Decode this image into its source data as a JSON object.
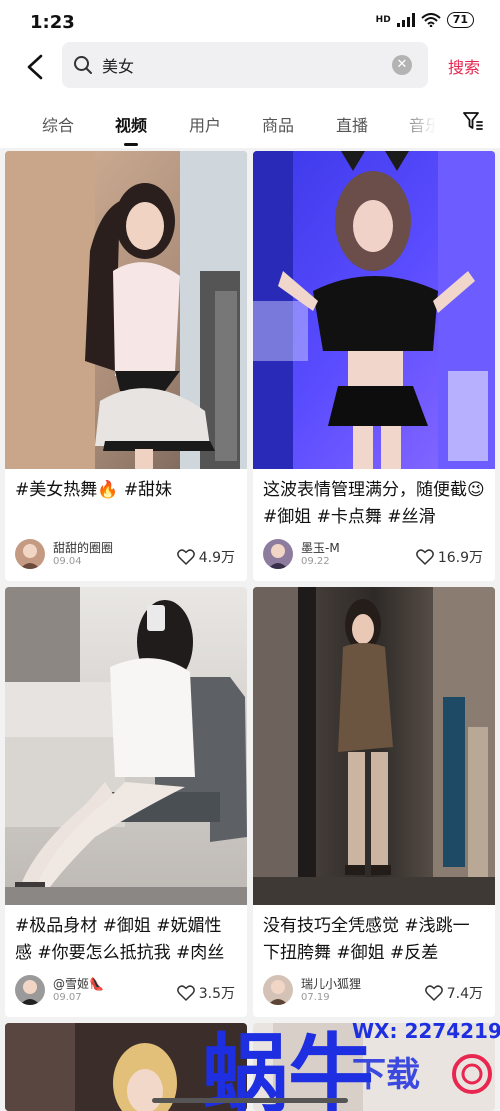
{
  "status_bar": {
    "time": "1:23",
    "network": "HD",
    "battery": "71"
  },
  "search": {
    "query": "美女",
    "submit_label": "搜索"
  },
  "tabs": [
    {
      "label": "综合",
      "active": false
    },
    {
      "label": "视频",
      "active": true
    },
    {
      "label": "用户",
      "active": false
    },
    {
      "label": "商品",
      "active": false
    },
    {
      "label": "直播",
      "active": false
    },
    {
      "label": "音乐",
      "active": false
    }
  ],
  "feed": [
    {
      "title": "#美女热舞🔥 #甜妹",
      "author": "甜甜的圈圈",
      "date": "09.04",
      "likes": "4.9万"
    },
    {
      "title": "这波表情管理满分，随便截😉 #御姐 #卡点舞 #丝滑",
      "author": "墨玉-M",
      "date": "09.22",
      "likes": "16.9万"
    },
    {
      "title": "#极品身材 #御姐 #妩媚性感 #你要怎么抵抗我 #肉丝",
      "author": "@雪姬👠",
      "date": "09.07",
      "likes": "3.5万"
    },
    {
      "title": "没有技巧全凭感觉 #浅跳一下扭胯舞 #御姐 #反差",
      "author": "瑞儿小狐狸",
      "date": "07.19",
      "likes": "7.4万"
    }
  ],
  "watermark": {
    "text": "蜗牛",
    "contact": "WX: 2274219",
    "subtext": "下载"
  },
  "icons": [
    "back-arrow-icon",
    "search-icon",
    "clear-icon",
    "filter-icon",
    "heart-icon",
    "signal-icon",
    "wifi-icon",
    "battery-icon"
  ],
  "colors": {
    "accent": "#e8264f",
    "background": "#f2f2f2",
    "watermark_blue": "#1d2fe0"
  }
}
